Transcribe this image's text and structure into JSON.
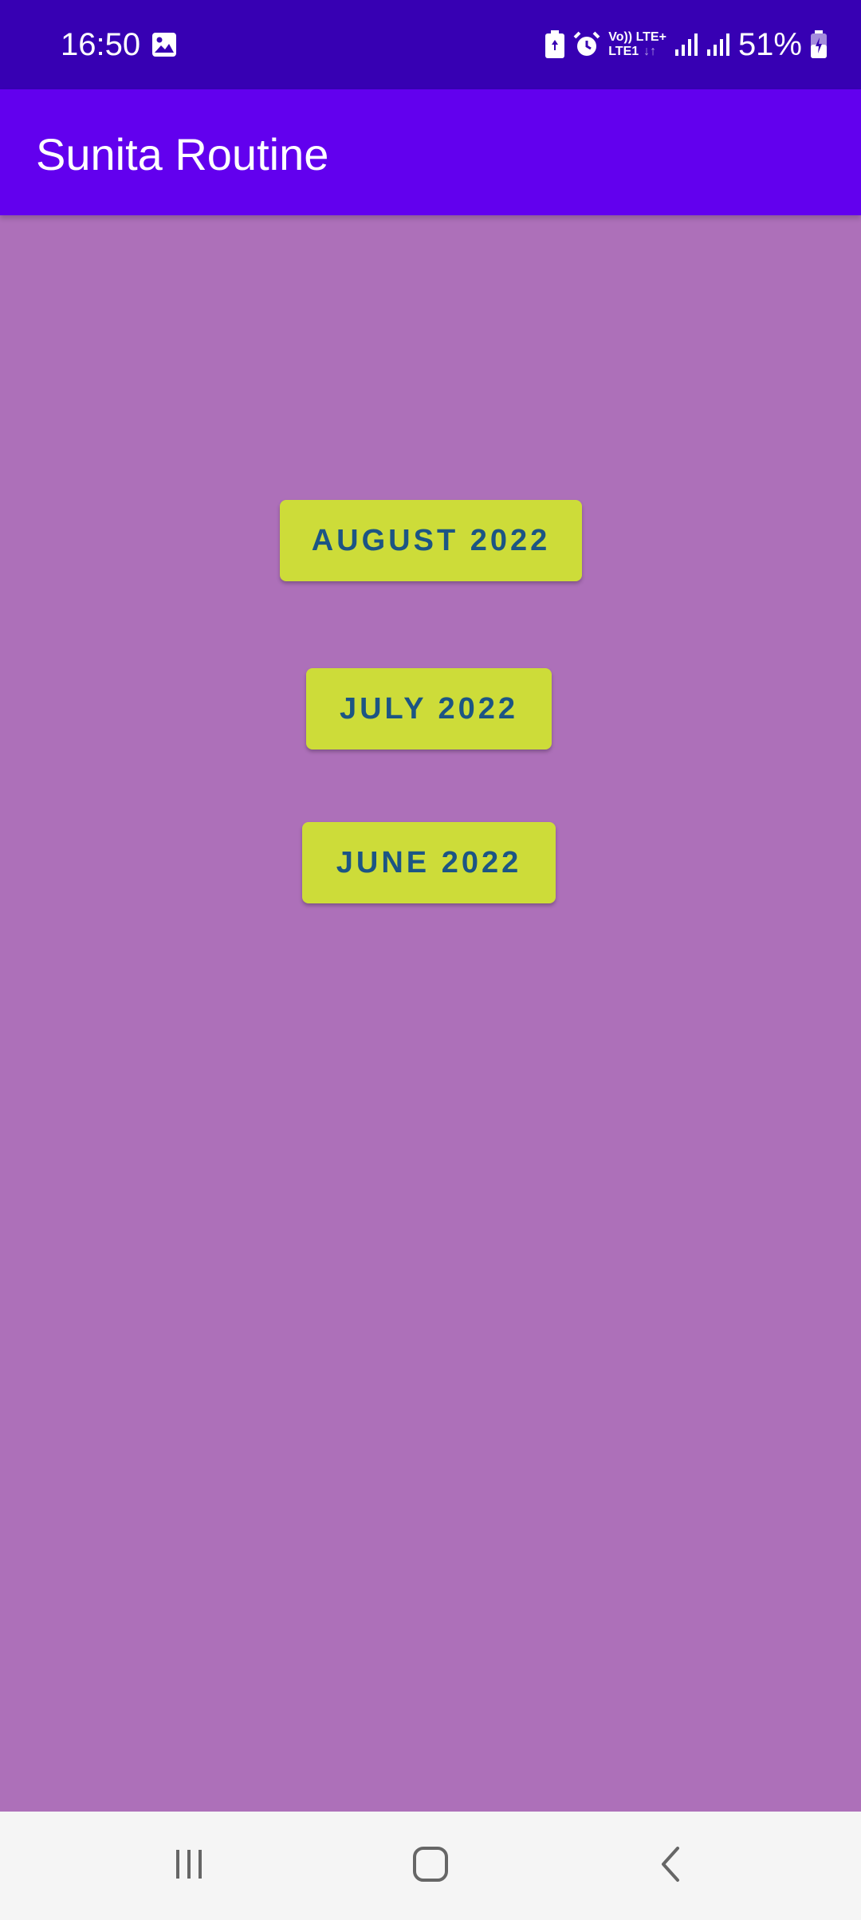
{
  "status_bar": {
    "time": "16:50",
    "network_top": "Vo)) LTE+",
    "network_bottom": "LTE1",
    "battery_percent": "51%",
    "icons": [
      "gallery-icon",
      "battery-saver-icon",
      "alarm-icon",
      "signal-icon",
      "signal-icon",
      "battery-icon"
    ]
  },
  "app_bar": {
    "title": "Sunita Routine"
  },
  "buttons": {
    "august": "AUGUST 2022",
    "july": "JULY 2022",
    "june": "JUNE 2022"
  },
  "nav_bar": {
    "icons": [
      "recents-icon",
      "home-icon",
      "back-icon"
    ]
  },
  "colors": {
    "status_bar": "#3700b3",
    "app_bar": "#6200ee",
    "background": "#ad70b9",
    "button_bg": "#cddc39",
    "button_text": "#1c5584",
    "nav_bar": "#f5f5f5"
  }
}
